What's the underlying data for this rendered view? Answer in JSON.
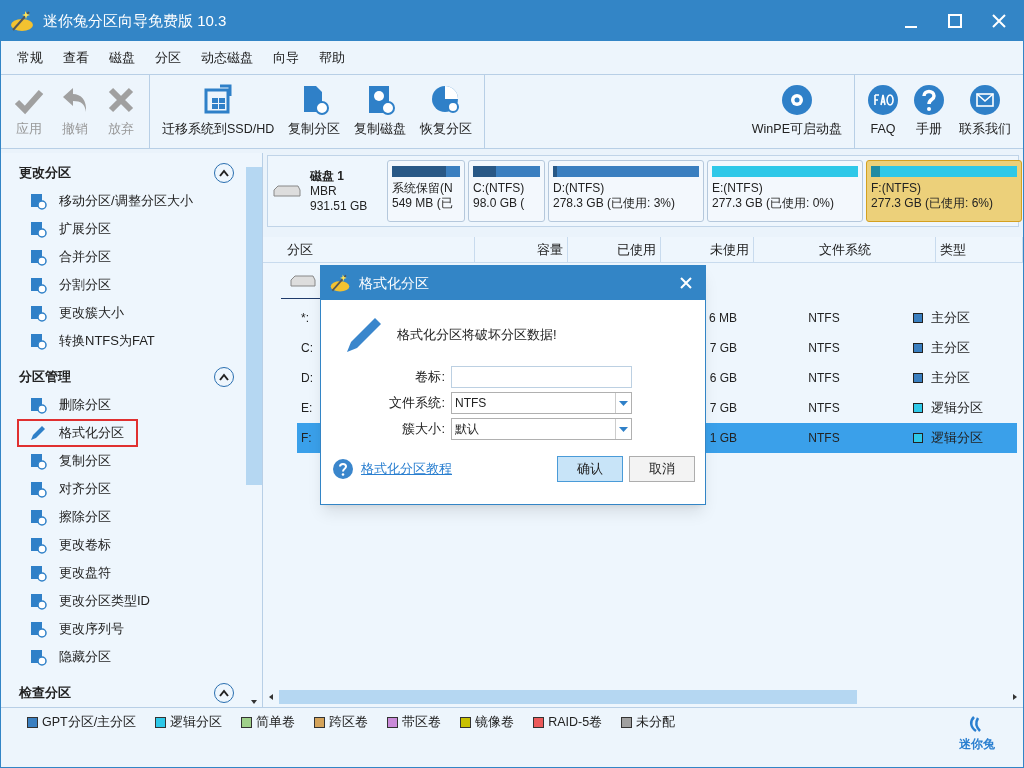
{
  "window": {
    "title": "迷你兔分区向导免费版 10.3"
  },
  "menu": [
    "常规",
    "查看",
    "磁盘",
    "分区",
    "动态磁盘",
    "向导",
    "帮助"
  ],
  "toolbar": {
    "groups": [
      [
        {
          "label": "应用",
          "disabled": true
        },
        {
          "label": "撤销",
          "disabled": true
        },
        {
          "label": "放弃",
          "disabled": true
        }
      ],
      [
        {
          "label": "迁移系统到SSD/HD",
          "disabled": false
        },
        {
          "label": "复制分区",
          "disabled": false
        },
        {
          "label": "复制磁盘",
          "disabled": false
        },
        {
          "label": "恢复分区",
          "disabled": false
        }
      ],
      [
        {
          "label": "WinPE可启动盘",
          "disabled": false
        }
      ],
      [
        {
          "label": "FAQ",
          "disabled": false
        },
        {
          "label": "手册",
          "disabled": false
        },
        {
          "label": "联系我们",
          "disabled": false
        }
      ]
    ]
  },
  "sidebar": {
    "sections": [
      {
        "title": "更改分区",
        "expanded": true,
        "items": [
          {
            "label": "移动分区/调整分区大小",
            "selected": false
          },
          {
            "label": "扩展分区",
            "selected": false
          },
          {
            "label": "合并分区",
            "selected": false
          },
          {
            "label": "分割分区",
            "selected": false
          },
          {
            "label": "更改簇大小",
            "selected": false
          },
          {
            "label": "转换NTFS为FAT",
            "selected": false
          }
        ]
      },
      {
        "title": "分区管理",
        "expanded": true,
        "items": [
          {
            "label": "删除分区",
            "selected": false
          },
          {
            "label": "格式化分区",
            "selected": true
          },
          {
            "label": "复制分区",
            "selected": false
          },
          {
            "label": "对齐分区",
            "selected": false
          },
          {
            "label": "擦除分区",
            "selected": false
          },
          {
            "label": "更改卷标",
            "selected": false
          },
          {
            "label": "更改盘符",
            "selected": false
          },
          {
            "label": "更改分区类型ID",
            "selected": false
          },
          {
            "label": "更改序列号",
            "selected": false
          },
          {
            "label": "隐藏分区",
            "selected": false
          }
        ]
      },
      {
        "title": "检查分区",
        "expanded": true
      }
    ]
  },
  "disk_map": {
    "disk": {
      "name": "磁盘 1",
      "scheme": "MBR",
      "size": "931.51 GB"
    },
    "partitions": [
      {
        "name": "系统保留(N",
        "size": "549 MB (已",
        "color": "#3a7fc0",
        "level": 0.8,
        "selected": false
      },
      {
        "name": "C:(NTFS)",
        "size": "98.0 GB (",
        "color": "#3a7fc0",
        "level": 0.35,
        "selected": false
      },
      {
        "name": "D:(NTFS)",
        "size": "278.3 GB (已使用: 3%)",
        "color": "#3a7fc0",
        "level": 0.03,
        "selected": false
      },
      {
        "name": "E:(NTFS)",
        "size": "277.3 GB (已使用: 0%)",
        "color": "#2ec8e8",
        "selected": false
      },
      {
        "name": "F:(NTFS)",
        "size": "277.3 GB (已使用: 6%)",
        "color": "#2ec8e8",
        "level": 0.06,
        "selected": true
      }
    ]
  },
  "table": {
    "columns": [
      "分区",
      "容量",
      "已使用",
      "未使用",
      "文件系统",
      "类型"
    ],
    "rows": [
      {
        "partition": "*:",
        "unused": "6 MB",
        "fs": "NTFS",
        "type": "主分区",
        "color": "#3a7fc0",
        "selected": false
      },
      {
        "partition": "C:",
        "unused": "7 GB",
        "fs": "NTFS",
        "type": "主分区",
        "color": "#3a7fc0",
        "selected": false
      },
      {
        "partition": "D:",
        "unused": "6 GB",
        "fs": "NTFS",
        "type": "主分区",
        "color": "#3a7fc0",
        "selected": false
      },
      {
        "partition": "E:",
        "unused": "7 GB",
        "fs": "NTFS",
        "type": "逻辑分区",
        "color": "#2ec8e8",
        "selected": false
      },
      {
        "partition": "F:",
        "unused": "1 GB",
        "fs": "NTFS",
        "type": "逻辑分区",
        "color": "#2ec8e8",
        "selected": true
      }
    ]
  },
  "dialog": {
    "title": "格式化分区",
    "message": "格式化分区将破坏分区数据!",
    "fields": [
      {
        "kind": "text",
        "label": "卷标:"
      },
      {
        "kind": "select",
        "label": "文件系统:",
        "value": "NTFS"
      },
      {
        "kind": "select",
        "label": "簇大小:",
        "value": "默认"
      }
    ],
    "help_link": "格式化分区教程",
    "buttons": [
      {
        "label": "确认",
        "default": true
      },
      {
        "label": "取消",
        "default": false
      }
    ]
  },
  "legend": [
    {
      "label": "GPT分区/主分区",
      "color": "#3a7fc0"
    },
    {
      "label": "逻辑分区",
      "color": "#2ec8e8"
    },
    {
      "label": "简单卷",
      "color": "#9fd08a"
    },
    {
      "label": "跨区卷",
      "color": "#d4a35a"
    },
    {
      "label": "带区卷",
      "color": "#c98ad8"
    },
    {
      "label": "镜像卷",
      "color": "#c8c000"
    },
    {
      "label": "RAID-5卷",
      "color": "#ec5a5a"
    },
    {
      "label": "未分配",
      "color": "#a0a0a0"
    }
  ],
  "logo": "迷你兔"
}
